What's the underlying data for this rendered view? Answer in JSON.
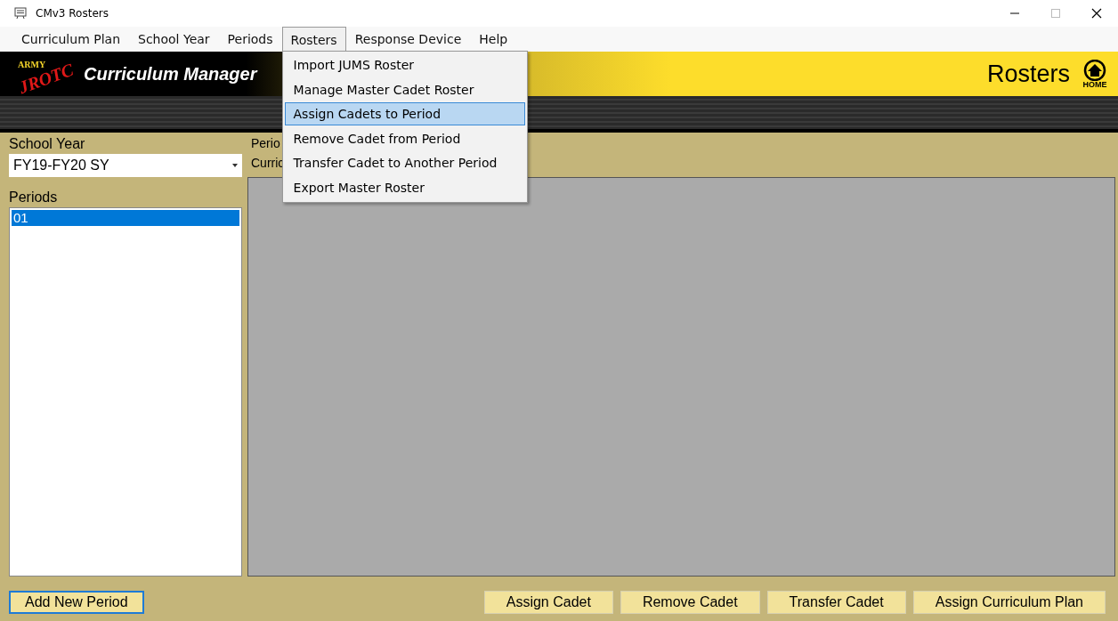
{
  "window": {
    "title": "CMv3 Rosters"
  },
  "menu_bar": [
    {
      "label": "Curriculum Plan",
      "selected": false
    },
    {
      "label": "School Year",
      "selected": false
    },
    {
      "label": "Periods",
      "selected": false
    },
    {
      "label": "Rosters",
      "selected": true,
      "dropdown": [
        {
          "label": "Import JUMS Roster",
          "selected": false
        },
        {
          "label": "Manage Master Cadet Roster",
          "selected": false
        },
        {
          "label": "Assign Cadets to Period",
          "selected": true
        },
        {
          "label": "Remove Cadet from Period",
          "selected": false
        },
        {
          "label": "Transfer Cadet to Another Period",
          "selected": false
        },
        {
          "label": "Export Master Roster",
          "selected": false
        }
      ]
    },
    {
      "label": "Response Device",
      "selected": false
    },
    {
      "label": "Help",
      "selected": false
    }
  ],
  "banner": {
    "logo_top": "ARMY",
    "logo_script": "JROTC",
    "app_name": "Curriculum Manager",
    "page_title": "Rosters",
    "home_label": "HOME"
  },
  "left_panel": {
    "school_year_label": "School Year",
    "school_year_value": "FY19-FY20 SY",
    "periods_label": "Periods",
    "periods": [
      {
        "label": "01",
        "selected": true
      }
    ]
  },
  "right_panel": {
    "period_label": "Perio",
    "curriculum_label": "Curric"
  },
  "buttons_left": [
    "Add New Period"
  ],
  "buttons_right": [
    "Assign Cadet",
    "Remove Cadet",
    "Transfer Cadet",
    "Assign Curriculum Plan"
  ]
}
